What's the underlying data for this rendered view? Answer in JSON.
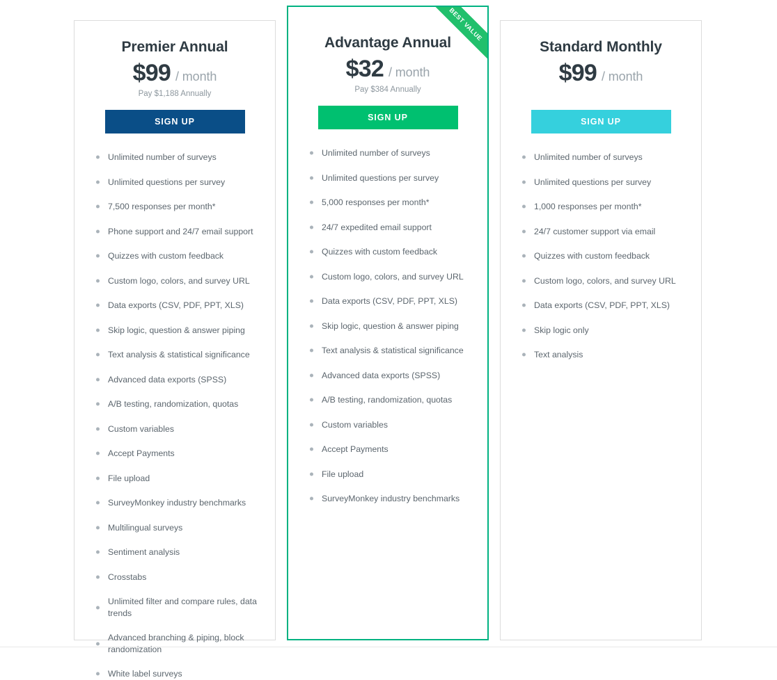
{
  "page": {
    "background": "#ffffff",
    "accent_navy": "#0a4e87",
    "accent_green": "#00c070",
    "accent_teal": "#35d0dd",
    "featured_border": "#00b281",
    "ribbon_color": "#21c06c"
  },
  "plans": [
    {
      "id": "premier-annual",
      "name": "Premier Annual",
      "price_amount": "$99",
      "price_period": "/ month",
      "price_note": "Pay $1,188 Annually",
      "signup_label": "SIGN UP",
      "featured": false,
      "ribbon": "",
      "features": [
        "Unlimited number of surveys",
        "Unlimited questions per survey",
        "7,500 responses per month*",
        "Phone support and 24/7 email support",
        "Quizzes with custom feedback",
        "Custom logo, colors, and survey URL",
        "Data exports (CSV, PDF, PPT, XLS)",
        "Skip logic, question & answer piping",
        "Text analysis & statistical significance",
        "Advanced data exports (SPSS)",
        "A/B testing, randomization, quotas",
        "Custom variables",
        "Accept Payments",
        "File upload",
        "SurveyMonkey industry benchmarks",
        "Multilingual surveys",
        "Sentiment analysis",
        "Crosstabs",
        "Unlimited filter and compare rules, data trends",
        "Advanced branching & piping, block randomization",
        "White label surveys"
      ]
    },
    {
      "id": "advantage-annual",
      "name": "Advantage Annual",
      "price_amount": "$32",
      "price_period": "/ month",
      "price_note": "Pay $384 Annually",
      "signup_label": "SIGN UP",
      "featured": true,
      "ribbon": "BEST VALUE",
      "features": [
        "Unlimited number of surveys",
        "Unlimited questions per survey",
        "5,000 responses per month*",
        "24/7 expedited email support",
        "Quizzes with custom feedback",
        "Custom logo, colors, and survey URL",
        "Data exports (CSV, PDF, PPT, XLS)",
        "Skip logic, question & answer piping",
        "Text analysis & statistical significance",
        "Advanced data exports (SPSS)",
        "A/B testing, randomization, quotas",
        "Custom variables",
        "Accept Payments",
        "File upload",
        "SurveyMonkey industry benchmarks"
      ]
    },
    {
      "id": "standard-monthly",
      "name": "Standard Monthly",
      "price_amount": "$99",
      "price_period": "/ month",
      "price_note": "",
      "signup_label": "SIGN UP",
      "featured": false,
      "ribbon": "",
      "features": [
        "Unlimited number of surveys",
        "Unlimited questions per survey",
        "1,000 responses per month*",
        "24/7 customer support via email",
        "Quizzes with custom feedback",
        "Custom logo, colors, and survey URL",
        "Data exports (CSV, PDF, PPT, XLS)",
        "Skip logic only",
        "Text analysis"
      ]
    }
  ]
}
